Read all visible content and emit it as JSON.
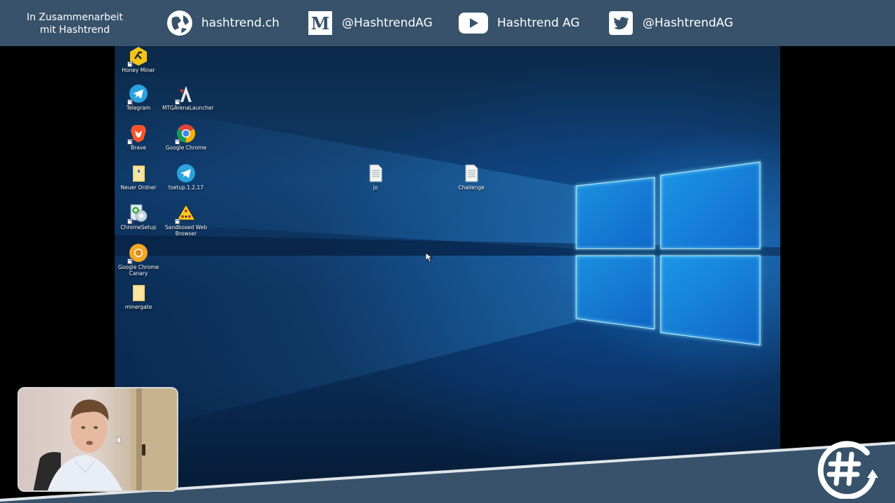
{
  "banner": {
    "collab_line1": "In Zusammenarbeit",
    "collab_line2": "mit Hashtrend",
    "links": [
      {
        "icon": "globe-icon",
        "label": "hashtrend.ch"
      },
      {
        "icon": "medium-icon",
        "label": "@HashtrendAG"
      },
      {
        "icon": "youtube-icon",
        "label": "Hashtrend AG"
      },
      {
        "icon": "twitter-icon",
        "label": "@HashtrendAG"
      }
    ]
  },
  "desktop": {
    "icons": [
      {
        "label": "Honey Miner",
        "icon": "honey-miner-icon"
      },
      {
        "label": "Telegram",
        "icon": "telegram-icon"
      },
      {
        "label": "MTGArenaLauncher",
        "icon": "mtg-arena-icon"
      },
      {
        "label": "Brave",
        "icon": "brave-icon"
      },
      {
        "label": "Google Chrome",
        "icon": "chrome-icon"
      },
      {
        "label": "Neuer Ordner",
        "icon": "folder-icon"
      },
      {
        "label": "tsetup.1.2.17",
        "icon": "telegram-icon"
      },
      {
        "label": "jo",
        "icon": "text-file-icon"
      },
      {
        "label": "Challenge",
        "icon": "text-file-icon"
      },
      {
        "label": "ChromeSetup",
        "icon": "installer-icon"
      },
      {
        "label": "Sandboxed Web Browser",
        "icon": "sandboxed-browser-icon"
      },
      {
        "label": "Google Chrome Canary",
        "icon": "chrome-canary-icon"
      },
      {
        "label": "minergate",
        "icon": "folder-icon"
      }
    ]
  },
  "colors": {
    "banner_bg": "#37526a",
    "bottom_band": "#37526a",
    "desktop_blue": "#0f3a6a",
    "win_glow": "#4fd0ff"
  }
}
